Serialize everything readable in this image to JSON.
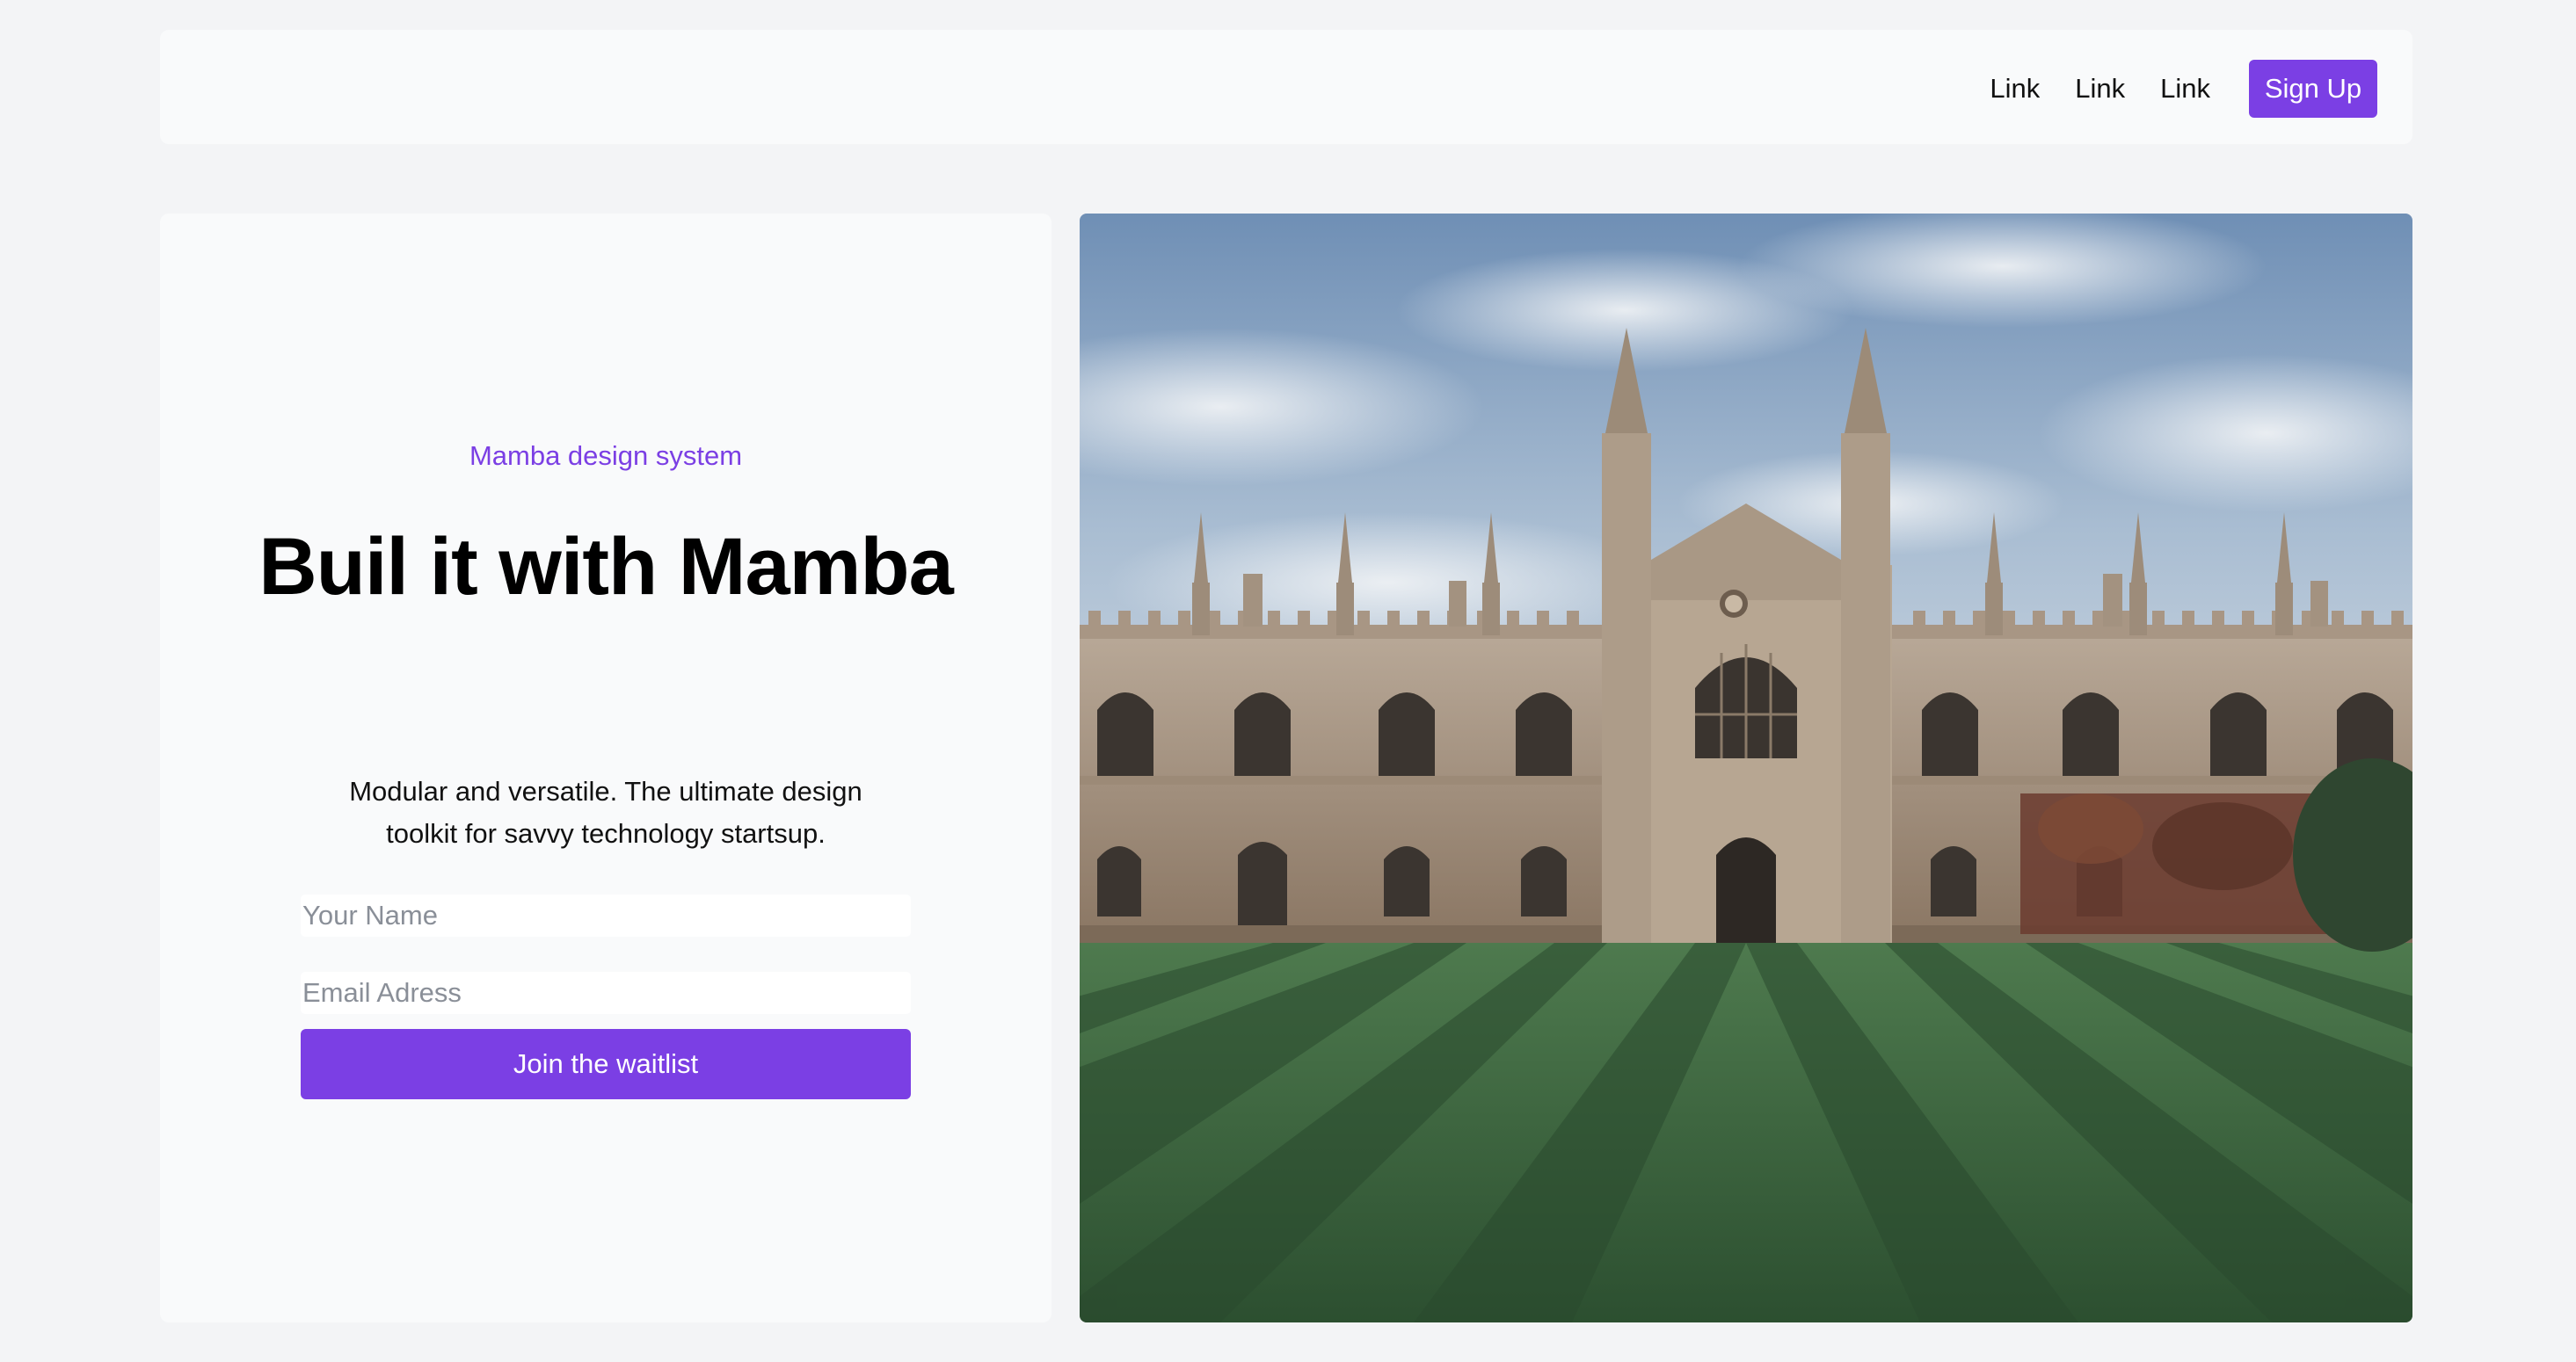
{
  "nav": {
    "links": [
      "Link",
      "Link",
      "Link"
    ],
    "signup_label": "Sign Up"
  },
  "hero": {
    "eyebrow": "Mamba design system",
    "title": "Buil it with Mamba",
    "subtitle": "Modular and versatile. The ultimate design toolkit for savvy technology startsup.",
    "name_placeholder": "Your Name",
    "email_placeholder": "Email Adress",
    "cta_label": "Join the waitlist",
    "image_subject": "gothic-college-building-with-striped-lawn"
  },
  "colors": {
    "accent": "#7b3fe4",
    "page_background": "#f3f4f6",
    "card_background": "#f9fafb"
  }
}
